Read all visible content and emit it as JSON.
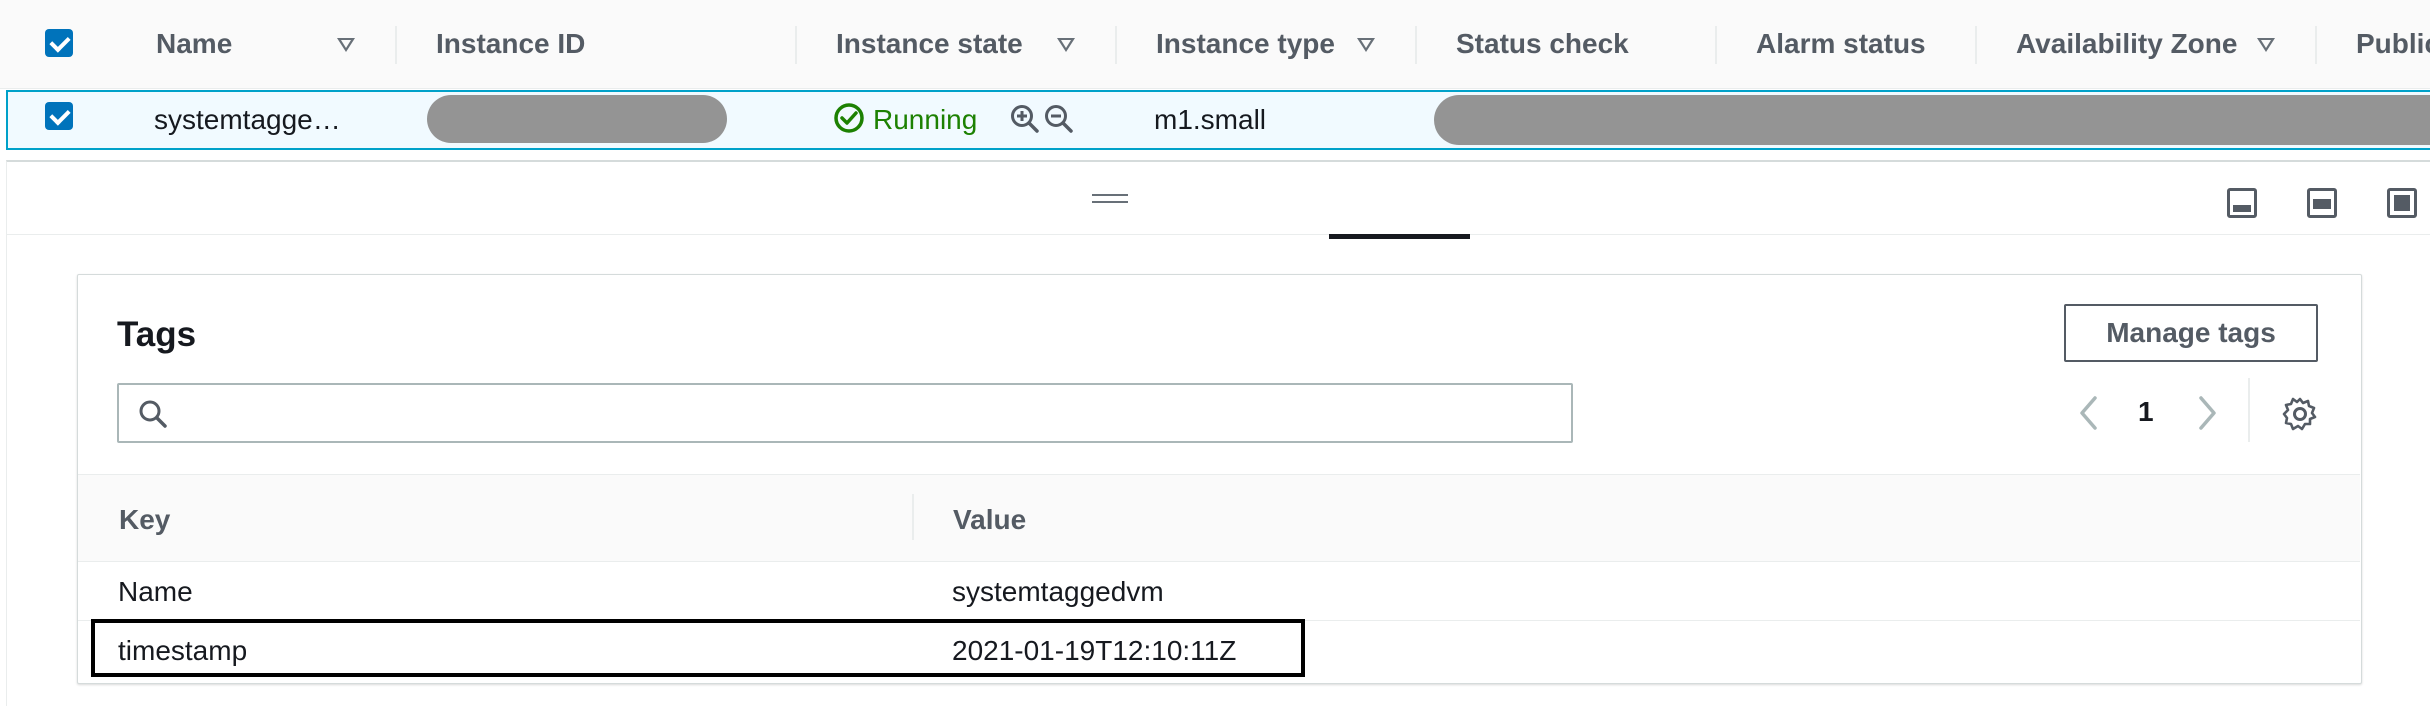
{
  "table": {
    "columns": {
      "name": "Name",
      "instance_id": "Instance ID",
      "instance_state": "Instance state",
      "instance_type": "Instance type",
      "status_check": "Status check",
      "alarm_status": "Alarm status",
      "availability_zone": "Availability Zone",
      "public": "Public"
    },
    "row": {
      "name": "systemtagge…",
      "state": "Running",
      "type": "m1.small"
    }
  },
  "tags_panel": {
    "title": "Tags",
    "manage_button": "Manage tags",
    "search_placeholder": "",
    "page_number": "1",
    "columns": {
      "key": "Key",
      "value": "Value"
    },
    "rows": [
      {
        "key": "Name",
        "value": "systemtaggedvm"
      },
      {
        "key": "timestamp",
        "value": "2021-01-19T12:10:11Z"
      }
    ]
  },
  "colors": {
    "running": "#1d8102",
    "checkbox": "#0073bb",
    "selected_row_border": "#00a1c9",
    "redacted": "#949494"
  },
  "icons": [
    "checkbox-checked-icon",
    "sort-icon",
    "check-circle-icon",
    "zoom-in-icon",
    "zoom-out-icon",
    "search-icon",
    "chevron-left-icon",
    "chevron-right-icon",
    "gear-icon",
    "panel-bottom-icon",
    "panel-side-icon",
    "panel-full-icon"
  ]
}
